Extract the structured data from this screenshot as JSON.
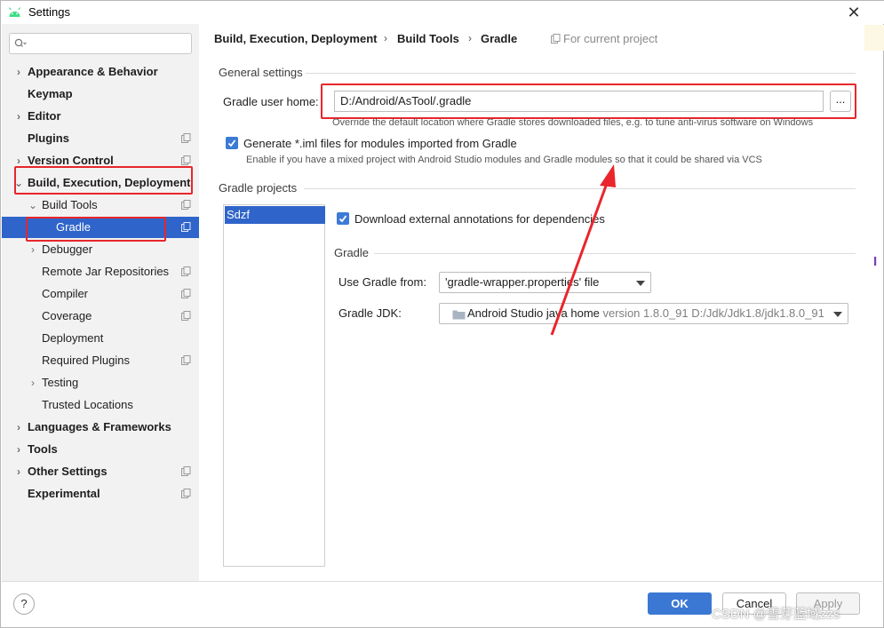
{
  "window": {
    "title": "Settings",
    "close": "✕"
  },
  "sidebar": {
    "items": [
      {
        "label": "Appearance & Behavior"
      },
      {
        "label": "Keymap"
      },
      {
        "label": "Editor"
      },
      {
        "label": "Plugins"
      },
      {
        "label": "Version Control"
      },
      {
        "label": "Build, Execution, Deployment"
      },
      {
        "label": "Build Tools"
      },
      {
        "label": "Gradle"
      },
      {
        "label": "Debugger"
      },
      {
        "label": "Remote Jar Repositories"
      },
      {
        "label": "Compiler"
      },
      {
        "label": "Coverage"
      },
      {
        "label": "Deployment"
      },
      {
        "label": "Required Plugins"
      },
      {
        "label": "Testing"
      },
      {
        "label": "Trusted Locations"
      },
      {
        "label": "Languages & Frameworks"
      },
      {
        "label": "Tools"
      },
      {
        "label": "Other Settings"
      },
      {
        "label": "Experimental"
      }
    ]
  },
  "breadcrumb": {
    "part1": "Build, Execution, Deployment",
    "part2": "Build Tools",
    "part3": "Gradle",
    "sep": "›",
    "scope": "For current project"
  },
  "general": {
    "title": "General settings",
    "home_label": "Gradle user home:",
    "home_value": "D:/Android/AsTool/.gradle",
    "browse": "...",
    "home_hint": "Override the default location where Gradle stores downloaded files, e.g. to tune anti-virus software on Windows",
    "iml_label": "Generate *.iml files for modules imported from Gradle",
    "iml_hint": "Enable if you have a mixed project with Android Studio modules and Gradle modules so that it could be shared via VCS"
  },
  "projects": {
    "title": "Gradle projects",
    "list": [
      "Sdzf"
    ],
    "download_label": "Download external annotations for dependencies",
    "gradle_title": "Gradle",
    "use_from_label": "Use Gradle from:",
    "use_from_value": "'gradle-wrapper.properties' file",
    "jdk_label": "Gradle JDK:",
    "jdk_name": "Android Studio java home",
    "jdk_detail": "version 1.8.0_91 D:/Jdk/Jdk1.8/jdk1.8.0_91"
  },
  "footer": {
    "help": "?",
    "ok": "OK",
    "cancel": "Cancel",
    "apply": "Apply"
  },
  "watermark": "CSDN @雪芽蓝域zzs",
  "colors": {
    "accent": "#2f65ca",
    "highlight_box": "#e8262b",
    "arrow": "#e8262b"
  }
}
